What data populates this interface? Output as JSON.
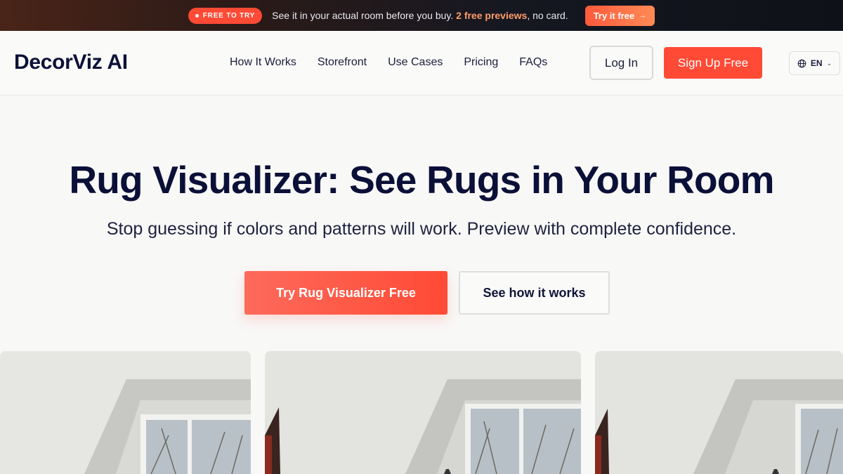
{
  "promo": {
    "badge": "FREE TO TRY",
    "text_before": "See it in your actual room before you buy. ",
    "text_highlight": "2 free previews",
    "text_after": ", no card.",
    "button_label": "Try it free",
    "button_arrow": "→"
  },
  "header": {
    "logo": "DecorViz AI",
    "nav": [
      "How It Works",
      "Storefront",
      "Use Cases",
      "Pricing",
      "FAQs"
    ],
    "login_label": "Log In",
    "signup_label": "Sign Up Free",
    "language": "EN"
  },
  "hero": {
    "title": "Rug Visualizer: See Rugs in Your Room",
    "subtitle": "Stop guessing if colors and patterns will work. Preview with complete confidence.",
    "primary_cta": "Try Rug Visualizer Free",
    "secondary_cta": "See how it works"
  },
  "gallery": {
    "cards": [
      {
        "image": "room-photo-left"
      },
      {
        "image": "room-photo-center"
      },
      {
        "image": "room-photo-right"
      }
    ]
  },
  "colors": {
    "accent": "#ff4a35",
    "heading": "#0b1038",
    "promo_highlight": "#ff9d6a"
  }
}
